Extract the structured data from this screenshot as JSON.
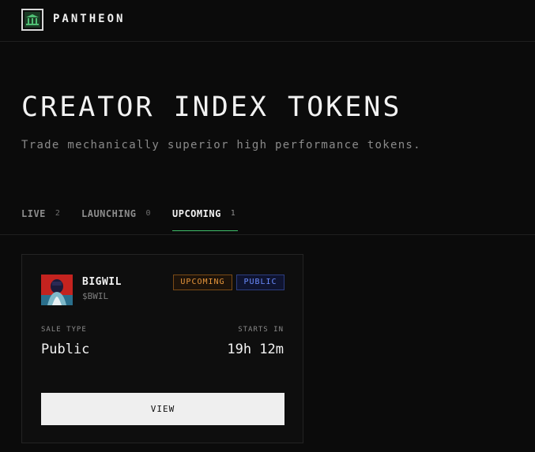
{
  "brand": {
    "name": "PANTHEON",
    "logo_icon": "temple-icon",
    "accent": "#3fbf6a"
  },
  "hero": {
    "title": "CREATOR INDEX TOKENS",
    "subtitle": "Trade mechanically superior high performance tokens."
  },
  "tabs": [
    {
      "label": "LIVE",
      "count": "2",
      "active": false
    },
    {
      "label": "LAUNCHING",
      "count": "0",
      "active": false
    },
    {
      "label": "UPCOMING",
      "count": "1",
      "active": true
    }
  ],
  "card": {
    "name": "BIGWIL",
    "ticker": "$BWIL",
    "status_badge": "UPCOMING",
    "access_badge": "PUBLIC",
    "sale_type_label": "SALE TYPE",
    "sale_type_value": "Public",
    "starts_in_label": "STARTS IN",
    "starts_in_value": "19h 12m",
    "button_label": "VIEW"
  }
}
